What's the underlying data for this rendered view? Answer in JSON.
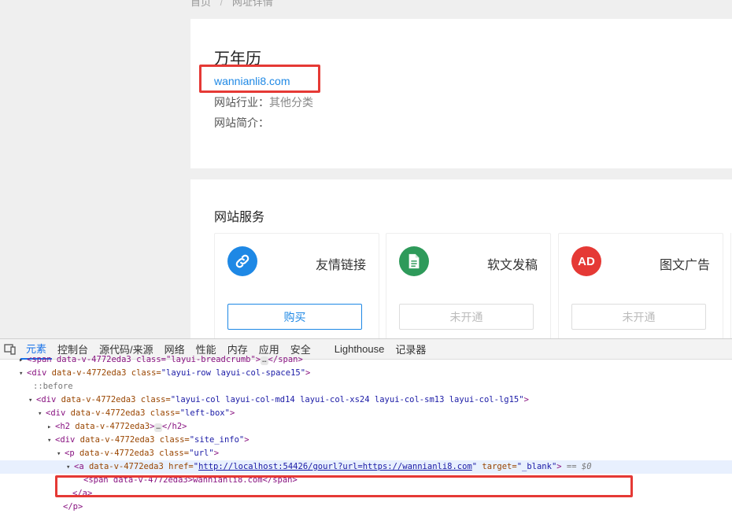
{
  "breadcrumb": {
    "home": "首页",
    "separator": "/",
    "current": "网址详情"
  },
  "site": {
    "name": "万年历",
    "url": "wannianli8.com",
    "industry_label": "网站行业：",
    "industry_value": "其他分类",
    "intro_label": "网站简介："
  },
  "services": {
    "title": "网站服务",
    "items": [
      {
        "name": "友情链接",
        "button": "购买",
        "icon": "link-icon",
        "color": "#1e88e5"
      },
      {
        "name": "软文发稿",
        "button": "未开通",
        "icon": "document-icon",
        "color": "#2e9a5a"
      },
      {
        "name": "图文广告",
        "button": "未开通",
        "icon": "ad-icon",
        "icon_text": "AD",
        "color": "#e53935"
      }
    ]
  },
  "devtools": {
    "tabs": [
      "元素",
      "控制台",
      "源代码/来源",
      "网络",
      "性能",
      "内存",
      "应用",
      "安全",
      "Lighthouse",
      "记录器"
    ],
    "active_tab": "元素",
    "lines": {
      "l0": "<span data-v-4772eda3 class=\"layui-breadcrumb\">",
      "l0_end": "</span>",
      "l1_tag": "<div",
      "l1_attr": "data-v-4772eda3",
      "l1_class_name": "class=",
      "l1_class_val": "\"layui-row layui-col-space15\"",
      "l2": "::before",
      "l3_tag": "<div",
      "l3_attr": "data-v-4772eda3",
      "l3_class_name": "class=",
      "l3_class_val": "\"layui-col layui-col-md14 layui-col-xs24 layui-col-sm13 layui-col-lg15\"",
      "l4_tag": "<div",
      "l4_attr": "data-v-4772eda3",
      "l4_class_name": "class=",
      "l4_class_val": "\"left-box\"",
      "l5_tag": "<h2",
      "l5_attr": "data-v-4772eda3",
      "l5_end": "</h2>",
      "l6_tag": "<div",
      "l6_attr": "data-v-4772eda3",
      "l6_class_name": "class=",
      "l6_class_val": "\"site_info\"",
      "l7_tag": "<p",
      "l7_attr": "data-v-4772eda3",
      "l7_class_name": "class=",
      "l7_class_val": "\"url\"",
      "l8_tag": "<a",
      "l8_attr": "data-v-4772eda3",
      "l8_href_name": "href=",
      "l8_href_val": "http://localhost:54426/gourl?url=https://wannianli8.com",
      "l8_target_name": "target=",
      "l8_target_val": "\"_blank\"",
      "l8_eq": "== $0",
      "l9": "<span data-v-4772eda3>wannianli8.com</span>",
      "l10": "</a>",
      "l11": "</p>"
    }
  }
}
